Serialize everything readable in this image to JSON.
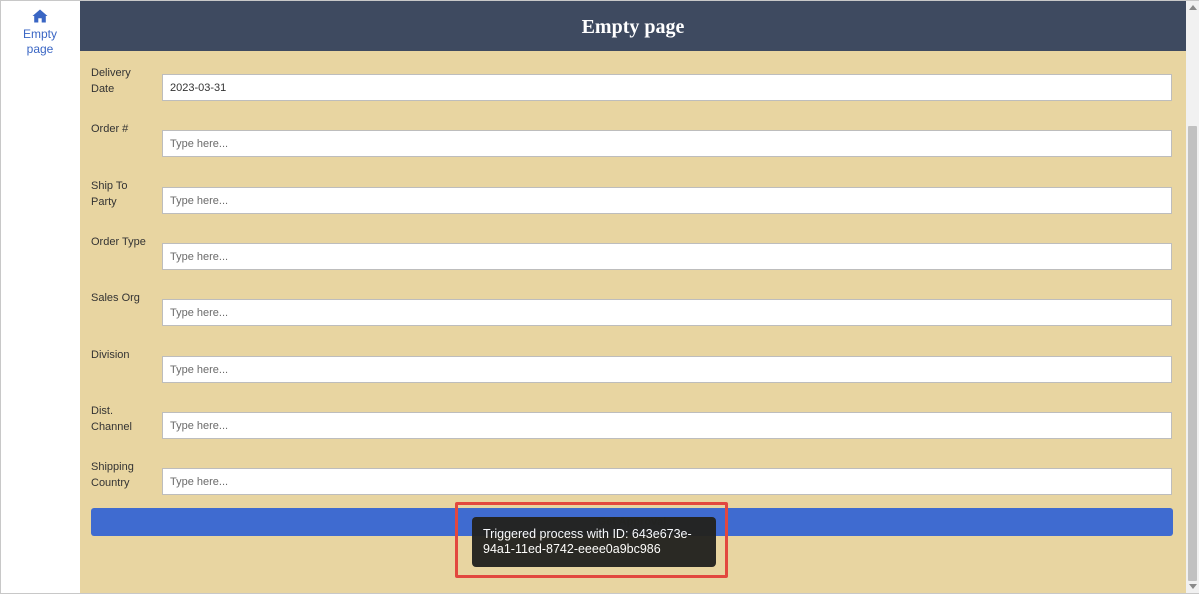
{
  "sidebar": {
    "home_label_line1": "Empty",
    "home_label_line2": "page",
    "home_icon": "home-icon"
  },
  "header": {
    "title": "Empty page"
  },
  "form": {
    "fields": [
      {
        "label": "Delivery Date",
        "value": "2023-03-31",
        "placeholder": "Type here..."
      },
      {
        "label": "Order #",
        "value": "",
        "placeholder": "Type here..."
      },
      {
        "label": "Ship To Party",
        "value": "",
        "placeholder": "Type here..."
      },
      {
        "label": "Order Type",
        "value": "",
        "placeholder": "Type here..."
      },
      {
        "label": "Sales Org",
        "value": "",
        "placeholder": "Type here..."
      },
      {
        "label": "Division",
        "value": "",
        "placeholder": "Type here..."
      },
      {
        "label": "Dist. Channel",
        "value": "",
        "placeholder": "Type here..."
      },
      {
        "label": "Shipping Country",
        "value": "",
        "placeholder": "Type here..."
      }
    ],
    "submit_label": "Get Approval"
  },
  "toast": {
    "message": "Triggered process with ID: 643e673e-94a1-11ed-8742-eeee0a9bc986"
  },
  "colors": {
    "header_bg": "#3e4a60",
    "form_bg": "#e8d5a1",
    "button_bg": "#3f6bd0",
    "link": "#3a66c4",
    "toast_bg": "#23231f",
    "highlight": "#e2483f"
  }
}
